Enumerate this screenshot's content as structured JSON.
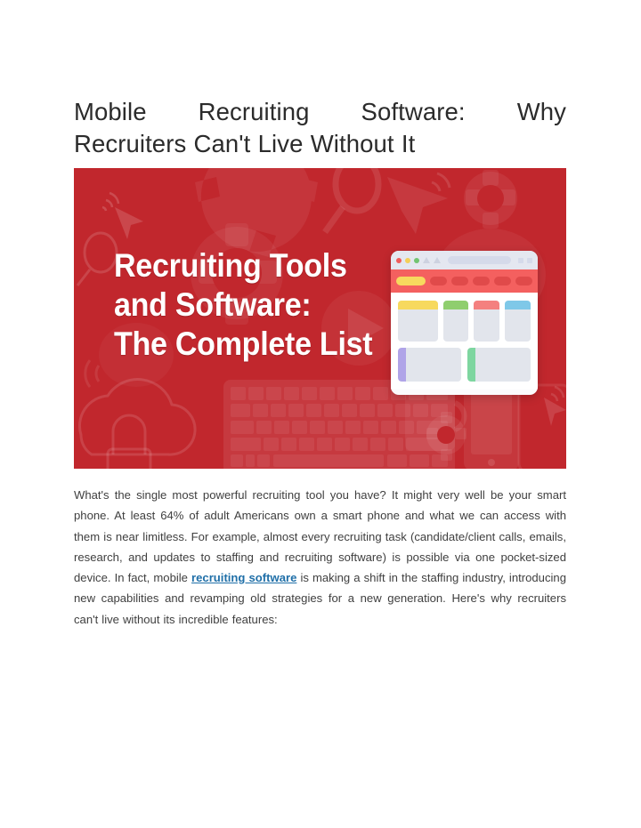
{
  "document": {
    "title_line1": "Mobile Recruiting Software: Why",
    "title_line2": "Recruiters Can't Live Without It"
  },
  "banner": {
    "background_color": "#c1272d",
    "heading_line1": "Recruiting Tools",
    "heading_line2": "and Software:",
    "heading_line3": "The Complete List",
    "decorative_icons": [
      "cursor-signal-icon",
      "magnifier-icon",
      "gear-icon",
      "paper-plane-icon",
      "speech-bubble-icon",
      "cloud-lock-icon",
      "keyboard-icon",
      "smartphone-icon",
      "coffee-mug-icon",
      "play-button-icon"
    ],
    "browser_mockup": {
      "traffic_lights": [
        "#f05b5b",
        "#f4cf58",
        "#72c472"
      ],
      "nav_bar_color": "#f4605f",
      "active_tab_color": "#f7d95e",
      "inactive_tab_color": "#e04a4a",
      "card_accents": [
        "#f7d95e",
        "#8fce6e",
        "#f4807f",
        "#7fc8e8"
      ],
      "wide_card_accents": [
        "#b0a4e8",
        "#7ed6a0"
      ]
    }
  },
  "article": {
    "paragraph_part1": "What's the single most powerful recruiting tool you have? It might very well be your smart phone. At least 64% of adult Americans own a smart phone and what we can access with them is near limitless. For example, almost every recruiting task (candidate/client calls, emails, research, and updates to staffing and recruiting software) is possible via one pocket-sized device. In fact, mobile ",
    "link_text": "recruiting software",
    "paragraph_part2": " is making a shift in the staffing industry, introducing new capabilities and revamping old strategies for a new generation. Here's why recruiters can't live without its incredible features:",
    "link_color": "#1f6fa8"
  }
}
